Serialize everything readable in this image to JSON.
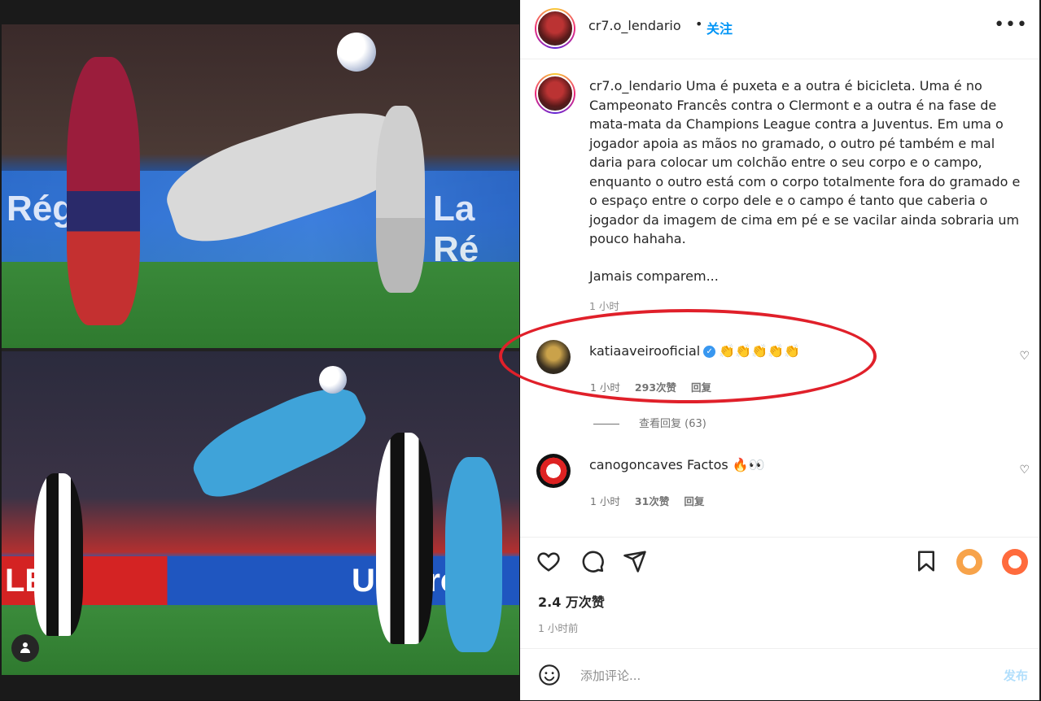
{
  "post": {
    "username": "cr7.o_lendario",
    "dot": "•",
    "follow_label": "关注",
    "more_label": "•••",
    "caption_text": "Uma é puxeta e a outra é bicicleta. Uma é no Campeonato Francês contra o Clermont e a outra é na fase de mata-mata da Champions League contra a Juventus. Em uma o jogador apoia as mãos no gramado, o outro pé também e mal daria para colocar um colchão entre o seu corpo e o campo, enquanto o outro está com o corpo totalmente fora do gramado e o espaço entre o corpo dele e o campo é tanto que caberia o jogador da imagem de cima em pé e se vacilar ainda sobraria um pouco hahaha.",
    "caption_tail": "Jamais comparem...",
    "caption_time": "1 小时"
  },
  "media": {
    "top_banner": "Régi",
    "top_banner_right": "La Ré",
    "bottom_banner_left": "LE",
    "bottom_banner_right": "UniCredit"
  },
  "comments": [
    {
      "username": "katiaaveirooficial",
      "verified": "✓",
      "text": "👏👏👏👏👏",
      "time": "1 小时",
      "likes": "293次赞",
      "reply": "回复"
    },
    {
      "username": "canogoncaves",
      "text": "Factos 🔥👀",
      "time": "1 小时",
      "likes": "31次赞",
      "reply": "回复"
    }
  ],
  "view_replies_label": "查看回复 (63)",
  "likes_label": "2.4 万次赞",
  "posted_label": "1 小时前",
  "add_comment": {
    "placeholder": "添加评论...",
    "post_label": "发布"
  },
  "colors": {
    "accent": "#0095f6",
    "highlight": "#e0202a",
    "verified": "#3897f0"
  }
}
